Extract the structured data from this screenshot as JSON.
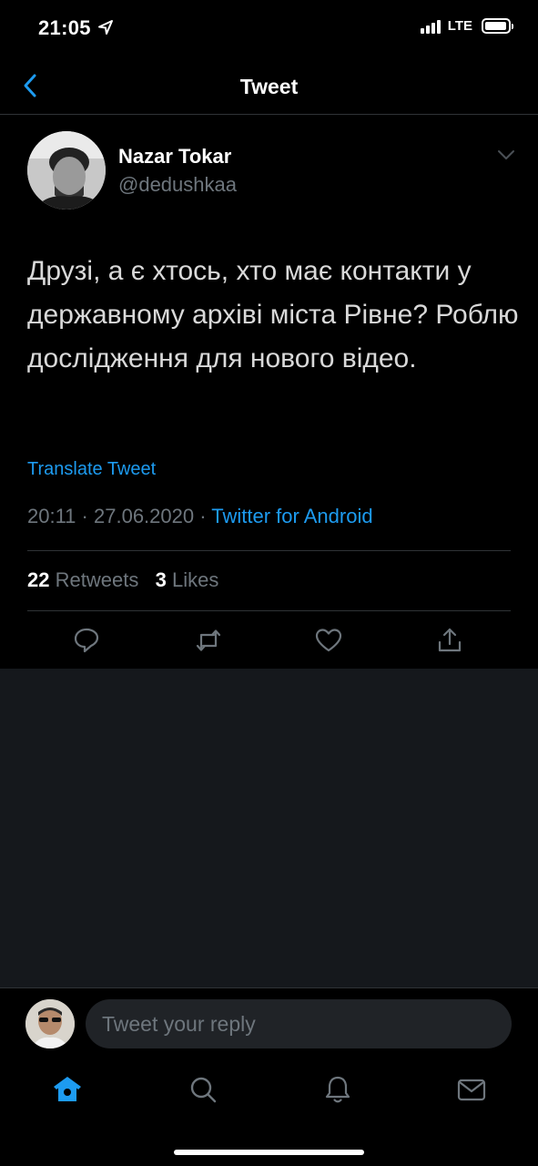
{
  "status_bar": {
    "time": "21:05",
    "network": "LTE"
  },
  "nav": {
    "title": "Tweet"
  },
  "tweet": {
    "author_name": "Nazar Tokar",
    "author_handle": "@dedushkaa",
    "text": "Друзі, а є хтось, хто має контакти у державному архіві міста Рівне? Роблю дослідження для нового відео.",
    "translate_label": "Translate Tweet",
    "time": "20:11",
    "date": "27.06.2020",
    "separator": "·",
    "client": "Twitter for Android",
    "retweets_count": "22",
    "retweets_label": "Retweets",
    "likes_count": "3",
    "likes_label": "Likes"
  },
  "icons": {
    "back": "chevron-left-icon",
    "caret": "chevron-down-icon",
    "reply": "reply-icon",
    "retweet": "retweet-icon",
    "like": "heart-icon",
    "share": "share-icon",
    "home": "home-icon",
    "search": "search-icon",
    "notifications": "bell-icon",
    "messages": "mail-icon"
  },
  "reply_bar": {
    "placeholder": "Tweet your reply"
  },
  "colors": {
    "accent": "#1d9bf0",
    "background": "#000000",
    "empty_background": "#15181c",
    "secondary_text": "#6e767d"
  }
}
